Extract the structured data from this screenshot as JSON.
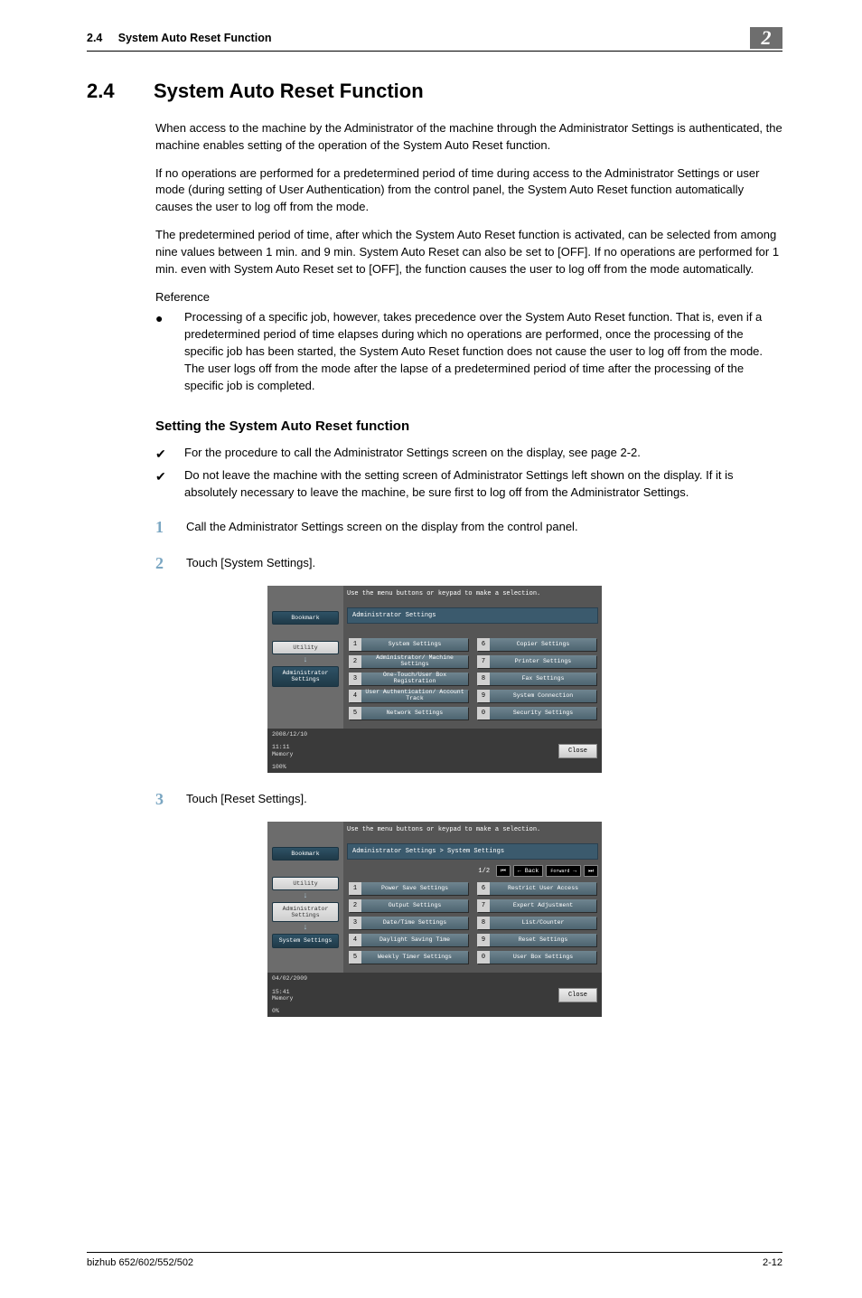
{
  "header": {
    "section_number": "2.4",
    "section_name": "System Auto Reset Function",
    "chapter": "2"
  },
  "title": {
    "num": "2.4",
    "text": "System Auto Reset Function"
  },
  "paragraphs": {
    "p1": "When access to the machine by the Administrator of the machine through the Administrator Settings is authenticated, the machine enables setting of the operation of the System Auto Reset function.",
    "p2": "If no operations are performed for a predetermined period of time during access to the Administrator Settings or user mode (during setting of User Authentication) from the control panel, the System Auto Reset function automatically causes the user to log off from the mode.",
    "p3": "The predetermined period of time, after which the System Auto Reset function is activated, can be selected from among nine values between 1 min. and 9 min. System Auto Reset can also be set to [OFF]. If no operations are performed for 1 min. even with System Auto Reset set to [OFF], the function causes the user to log off from the mode automatically."
  },
  "reference": {
    "label": "Reference",
    "bullets": [
      "Processing of a specific job, however, takes precedence over the System Auto Reset function. That is, even if a predetermined period of time elapses during which no operations are performed, once the processing of the specific job has been started, the System Auto Reset function does not cause the user to log off from the mode. The user logs off from the mode after the lapse of a predetermined period of time after the processing of the specific job is completed."
    ]
  },
  "subhead": "Setting the System Auto Reset function",
  "checks": [
    "For the procedure to call the Administrator Settings screen on the display, see page 2-2.",
    "Do not leave the machine with the setting screen of Administrator Settings left shown on the display. If it is absolutely necessary to leave the machine, be sure first to log off from the Administrator Settings."
  ],
  "steps": [
    "Call the Administrator Settings screen on the display from the control panel.",
    "Touch [System Settings].",
    "Touch [Reset Settings]."
  ],
  "screen1": {
    "instruction": "Use the menu buttons or keypad to make a selection.",
    "title": "Administrator Settings",
    "sidebar": {
      "bookmark": "Bookmark",
      "utility": "Utility",
      "admin": "Administrator Settings"
    },
    "buttons_left": [
      {
        "idx": "1",
        "label": "System Settings"
      },
      {
        "idx": "2",
        "label": "Administrator/ Machine Settings"
      },
      {
        "idx": "3",
        "label": "One-Touch/User Box Registration"
      },
      {
        "idx": "4",
        "label": "User Authentication/ Account Track"
      },
      {
        "idx": "5",
        "label": "Network Settings"
      }
    ],
    "buttons_right": [
      {
        "idx": "6",
        "label": "Copier Settings"
      },
      {
        "idx": "7",
        "label": "Printer Settings"
      },
      {
        "idx": "8",
        "label": "Fax Settings"
      },
      {
        "idx": "9",
        "label": "System Connection"
      },
      {
        "idx": "0",
        "label": "Security Settings"
      }
    ],
    "status": {
      "date": "2008/12/10",
      "time": "11:11",
      "mem_label": "Memory",
      "mem_val": "100%",
      "close": "Close"
    }
  },
  "screen2": {
    "instruction": "Use the menu buttons or keypad to make a selection.",
    "title": "Administrator Settings > System Settings",
    "page": "1/2",
    "back": "Back",
    "forward": "Forward",
    "sidebar": {
      "bookmark": "Bookmark",
      "utility": "Utility",
      "admin": "Administrator Settings",
      "system": "System Settings"
    },
    "buttons_left": [
      {
        "idx": "1",
        "label": "Power Save Settings"
      },
      {
        "idx": "2",
        "label": "Output Settings"
      },
      {
        "idx": "3",
        "label": "Date/Time Settings"
      },
      {
        "idx": "4",
        "label": "Daylight Saving Time"
      },
      {
        "idx": "5",
        "label": "Weekly Timer Settings"
      }
    ],
    "buttons_right": [
      {
        "idx": "6",
        "label": "Restrict User Access"
      },
      {
        "idx": "7",
        "label": "Expert Adjustment"
      },
      {
        "idx": "8",
        "label": "List/Counter"
      },
      {
        "idx": "9",
        "label": "Reset Settings"
      },
      {
        "idx": "0",
        "label": "User Box Settings"
      }
    ],
    "status": {
      "date": "04/02/2009",
      "time": "15:41",
      "mem_label": "Memory",
      "mem_val": "0%",
      "close": "Close"
    }
  },
  "footer": {
    "left": "bizhub 652/602/552/502",
    "right": "2-12"
  }
}
